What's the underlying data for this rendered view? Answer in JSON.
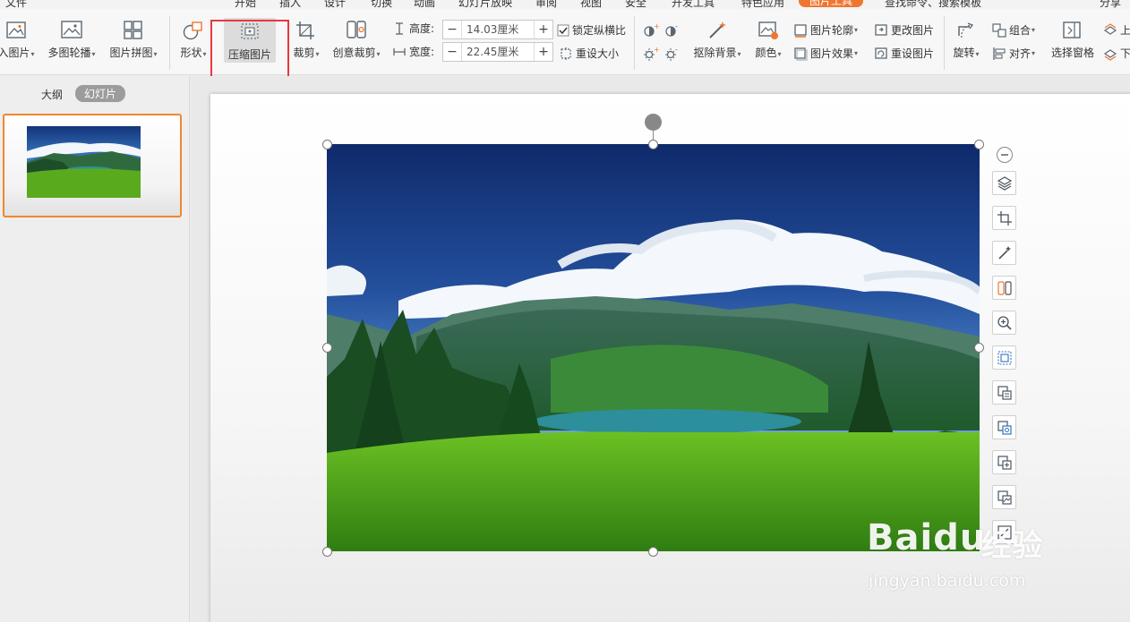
{
  "menu": {
    "file": "文件",
    "tabs": [
      "开始",
      "插入",
      "设计",
      "切换",
      "动画",
      "幻灯片放映",
      "审阅",
      "视图",
      "安全",
      "开发工具",
      "特色应用",
      "图片工具"
    ],
    "active_tab": "图片工具",
    "search": "查找命令、搜索模板",
    "share": "分享"
  },
  "ribbon": {
    "insert_picture": "入图片",
    "multi_carousel": "多图轮播",
    "picture_collage": "图片拼图",
    "shape": "形状",
    "compress_picture": "压缩图片",
    "crop": "裁剪",
    "creative_crop": "创意裁剪",
    "height_label": "高度:",
    "height_value": "14.03厘米",
    "width_label": "宽度:",
    "width_value": "22.45厘米",
    "lock_aspect": "锁定纵横比",
    "reset_size": "重设大小",
    "remove_background": "抠除背景",
    "color": "颜色",
    "picture_outline": "图片轮廓",
    "picture_effects": "图片效果",
    "change_picture": "更改图片",
    "reset_picture": "重设图片",
    "rotate": "旋转",
    "group": "组合",
    "align": "对齐",
    "selection_pane": "选择窗格",
    "bring_forward": "上",
    "send_backward": "下"
  },
  "left_panel": {
    "outline_tab": "大纲",
    "slides_tab": "幻灯片"
  },
  "watermark": {
    "brand": "Baidu",
    "brand_cn": "经验",
    "url": "jingyan.baidu.com"
  },
  "colors": {
    "accent": "#f0762f",
    "highlight": "#e8383d",
    "selection": "#f0872f"
  }
}
